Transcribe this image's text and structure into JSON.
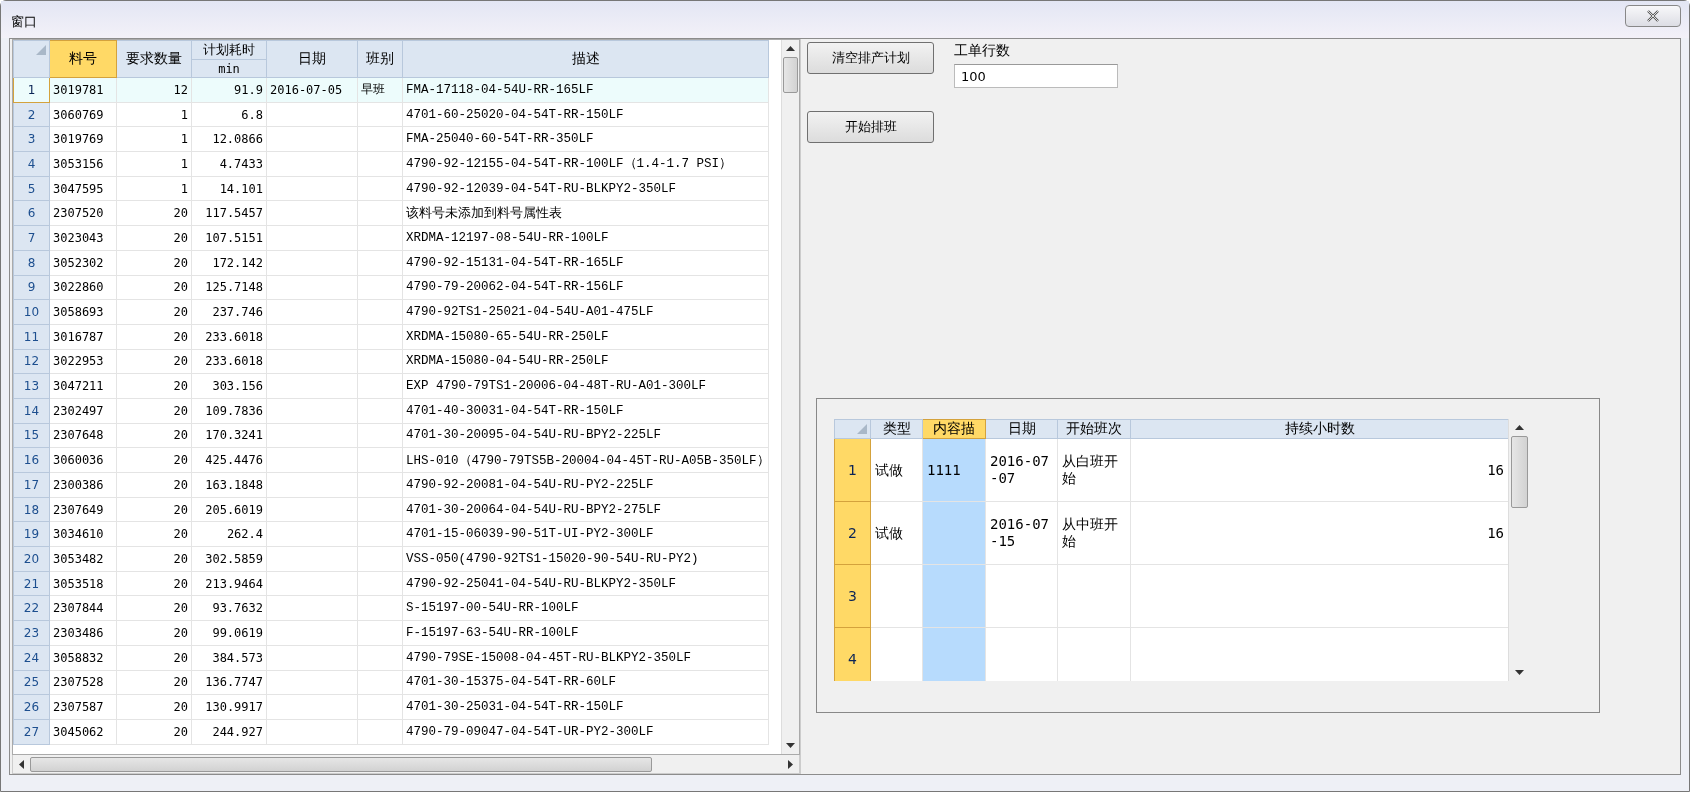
{
  "window": {
    "title": "窗口"
  },
  "main_table": {
    "columns": [
      {
        "label": "料号",
        "kind": "text",
        "selected": true
      },
      {
        "label": "要求数量",
        "kind": "number",
        "selected": false
      },
      {
        "label": "计划耗时",
        "sublabel": "min",
        "kind": "number",
        "selected": false
      },
      {
        "label": "日期",
        "kind": "text",
        "selected": false
      },
      {
        "label": "班别",
        "kind": "text",
        "selected": false
      },
      {
        "label": "描述",
        "kind": "text",
        "selected": false
      }
    ],
    "rows": [
      {
        "number": "1",
        "selected": true,
        "cells": [
          "3019781",
          "12",
          "91.9",
          "2016-07-05",
          "早班",
          "FMA-17118-04-54U-RR-165LF"
        ]
      },
      {
        "number": "2",
        "selected": false,
        "cells": [
          "3060769",
          "1",
          "6.8",
          null,
          null,
          "4701-60-25020-04-54T-RR-150LF"
        ]
      },
      {
        "number": "3",
        "selected": false,
        "cells": [
          "3019769",
          "1",
          "12.0866",
          null,
          null,
          "FMA-25040-60-54T-RR-350LF"
        ]
      },
      {
        "number": "4",
        "selected": false,
        "cells": [
          "3053156",
          "1",
          "4.7433",
          null,
          null,
          "4790-92-12155-04-54T-RR-100LF（1.4-1.7 PSI）"
        ]
      },
      {
        "number": "5",
        "selected": false,
        "cells": [
          "3047595",
          "1",
          "14.101",
          null,
          null,
          "4790-92-12039-04-54T-RU-BLKPY2-350LF"
        ]
      },
      {
        "number": "6",
        "selected": false,
        "cells": [
          "2307520",
          "20",
          "117.5457",
          null,
          null,
          "该料号未添加到料号属性表"
        ]
      },
      {
        "number": "7",
        "selected": false,
        "cells": [
          "3023043",
          "20",
          "107.5151",
          null,
          null,
          "XRDMA-12197-08-54U-RR-100LF"
        ]
      },
      {
        "number": "8",
        "selected": false,
        "cells": [
          "3052302",
          "20",
          "172.142",
          null,
          null,
          "4790-92-15131-04-54T-RR-165LF"
        ]
      },
      {
        "number": "9",
        "selected": false,
        "cells": [
          "3022860",
          "20",
          "125.7148",
          null,
          null,
          "4790-79-20062-04-54T-RR-156LF"
        ]
      },
      {
        "number": "10",
        "selected": false,
        "cells": [
          "3058693",
          "20",
          "237.746",
          null,
          null,
          "4790-92TS1-25021-04-54U-A01-475LF"
        ]
      },
      {
        "number": "11",
        "selected": false,
        "cells": [
          "3016787",
          "20",
          "233.6018",
          null,
          null,
          "XRDMA-15080-65-54U-RR-250LF"
        ]
      },
      {
        "number": "12",
        "selected": false,
        "cells": [
          "3022953",
          "20",
          "233.6018",
          null,
          null,
          "XRDMA-15080-04-54U-RR-250LF"
        ]
      },
      {
        "number": "13",
        "selected": false,
        "cells": [
          "3047211",
          "20",
          "303.156",
          null,
          null,
          "EXP 4790-79TS1-20006-04-48T-RU-A01-300LF"
        ]
      },
      {
        "number": "14",
        "selected": false,
        "cells": [
          "2302497",
          "20",
          "109.7836",
          null,
          null,
          "4701-40-30031-04-54T-RR-150LF"
        ]
      },
      {
        "number": "15",
        "selected": false,
        "cells": [
          "2307648",
          "20",
          "170.3241",
          null,
          null,
          "4701-30-20095-04-54U-RU-BPY2-225LF"
        ]
      },
      {
        "number": "16",
        "selected": false,
        "cells": [
          "3060036",
          "20",
          "425.4476",
          null,
          null,
          "LHS-010（4790-79TS5B-20004-04-45T-RU-A05B-350LF）"
        ]
      },
      {
        "number": "17",
        "selected": false,
        "cells": [
          "2300386",
          "20",
          "163.1848",
          null,
          null,
          "4790-92-20081-04-54U-RU-PY2-225LF"
        ]
      },
      {
        "number": "18",
        "selected": false,
        "cells": [
          "2307649",
          "20",
          "205.6019",
          null,
          null,
          "4701-30-20064-04-54U-RU-BPY2-275LF"
        ]
      },
      {
        "number": "19",
        "selected": false,
        "cells": [
          "3034610",
          "20",
          "262.4",
          null,
          null,
          "4701-15-06039-90-51T-UI-PY2-300LF"
        ]
      },
      {
        "number": "20",
        "selected": false,
        "cells": [
          "3053482",
          "20",
          "302.5859",
          null,
          null,
          "VSS-050(4790-92TS1-15020-90-54U-RU-PY2)"
        ]
      },
      {
        "number": "21",
        "selected": false,
        "cells": [
          "3053518",
          "20",
          "213.9464",
          null,
          null,
          "4790-92-25041-04-54U-RU-BLKPY2-350LF"
        ]
      },
      {
        "number": "22",
        "selected": false,
        "cells": [
          "2307844",
          "20",
          "93.7632",
          null,
          null,
          "S-15197-00-54U-RR-100LF"
        ]
      },
      {
        "number": "23",
        "selected": false,
        "cells": [
          "2303486",
          "20",
          "99.0619",
          null,
          null,
          "F-15197-63-54U-RR-100LF"
        ]
      },
      {
        "number": "24",
        "selected": false,
        "cells": [
          "3058832",
          "20",
          "384.573",
          null,
          null,
          "4790-79SE-15008-04-45T-RU-BLKPY2-350LF"
        ]
      },
      {
        "number": "25",
        "selected": false,
        "cells": [
          "2307528",
          "20",
          "136.7747",
          null,
          null,
          "4701-30-15375-04-54T-RR-60LF"
        ]
      },
      {
        "number": "26",
        "selected": false,
        "cells": [
          "2307587",
          "20",
          "130.9917",
          null,
          null,
          "4701-30-25031-04-54T-RR-150LF"
        ]
      },
      {
        "number": "27",
        "selected": false,
        "cells": [
          "3045062",
          "20",
          "244.927",
          null,
          null,
          "4790-79-09047-04-54T-UR-PY2-300LF"
        ]
      }
    ]
  },
  "buttons": [
    {
      "label": "清空排产计划"
    },
    {
      "label": "开始排班"
    }
  ],
  "row_count_field": {
    "label": "工单行数",
    "value": "100"
  },
  "schedule_table": {
    "columns": [
      {
        "label": "类型",
        "kind": "text",
        "selected": false
      },
      {
        "label": "内容描",
        "kind": "text",
        "selected": true
      },
      {
        "label": "日期",
        "kind": "text",
        "selected": false
      },
      {
        "label": "开始班次",
        "kind": "text",
        "selected": false
      },
      {
        "label": "持续小时数",
        "kind": "number",
        "selected": false
      }
    ],
    "rows": [
      {
        "number": "1",
        "selected": true,
        "cells": [
          "试做",
          "1111",
          "2016-07-07",
          "从白班开始",
          "16"
        ]
      },
      {
        "number": "2",
        "selected": true,
        "cells": [
          "试做",
          null,
          "2016-07-15",
          "从中班开始",
          "16"
        ]
      },
      {
        "number": "3",
        "selected": true,
        "cells": [
          null,
          null,
          null,
          null,
          null
        ]
      },
      {
        "number": "4",
        "selected": true,
        "cells": [
          null,
          null,
          null,
          null,
          null
        ]
      }
    ]
  }
}
